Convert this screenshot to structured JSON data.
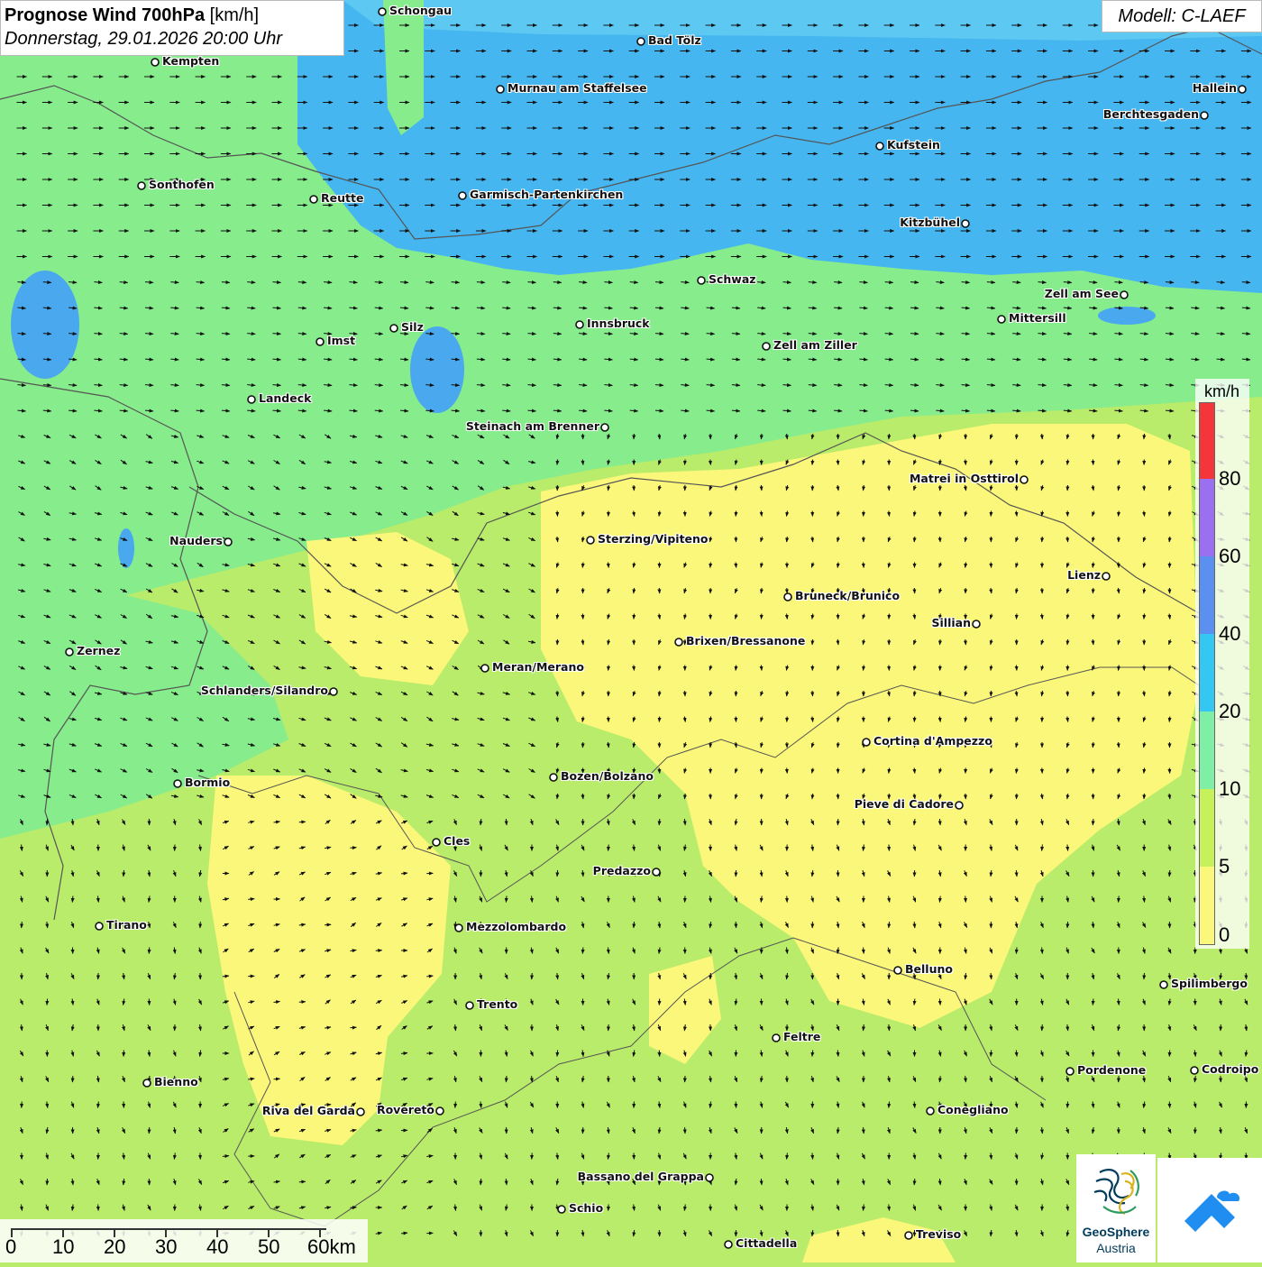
{
  "title": {
    "bold": "Prognose Wind 700hPa",
    "unit": " [km/h]",
    "date": "Donnerstag, 29.01.2026 20:00 Uhr"
  },
  "model": "Modell: C-LAEF",
  "legend": {
    "unit": "km/h",
    "colors": [
      "#fbf77a",
      "#c6f15b",
      "#7eefa5",
      "#34c7f2",
      "#5b8ff0",
      "#9a6ff0",
      "#f4363a"
    ],
    "labels": [
      "0",
      "5",
      "10",
      "20",
      "40",
      "60",
      "80"
    ]
  },
  "scale": {
    "labels": [
      "0",
      "10",
      "20",
      "30",
      "40",
      "50",
      "60km"
    ]
  },
  "colors": {
    "zone_0_5": "#fbf77a",
    "zone_5_10": "#c6f15b",
    "zone_10_20": "#7eefa5",
    "zone_20_40": "#34c7f2",
    "lake": "#4aa8ee",
    "border": "#555555"
  },
  "logos": {
    "geosphere": [
      "GeoSphere",
      "Austria"
    ]
  },
  "cities": [
    {
      "name": "Schongau",
      "side": "right"
    },
    {
      "name": "Bad Tölz",
      "side": "right"
    },
    {
      "name": "Kempten",
      "side": "right"
    },
    {
      "name": "Murnau am Staffelsee",
      "side": "right"
    },
    {
      "name": "Hallein",
      "side": "left"
    },
    {
      "name": "Berchtesgaden",
      "side": "left"
    },
    {
      "name": "Kufstein",
      "side": "right"
    },
    {
      "name": "Sonthofen",
      "side": "right"
    },
    {
      "name": "Reutte",
      "side": "right"
    },
    {
      "name": "Garmisch-Partenkirchen",
      "side": "right"
    },
    {
      "name": "Kitzbühel",
      "side": "left"
    },
    {
      "name": "Schwaz",
      "side": "right"
    },
    {
      "name": "Zell am See",
      "side": "left"
    },
    {
      "name": "Mittersill",
      "side": "right"
    },
    {
      "name": "Silz",
      "side": "right"
    },
    {
      "name": "Innsbruck",
      "side": "right"
    },
    {
      "name": "Imst",
      "side": "right"
    },
    {
      "name": "Zell am Ziller",
      "side": "right"
    },
    {
      "name": "Landeck",
      "side": "right"
    },
    {
      "name": "Steinach am Brenner",
      "side": "left"
    },
    {
      "name": "Matrei in Osttirol",
      "side": "left"
    },
    {
      "name": "Nauders",
      "side": "left"
    },
    {
      "name": "Sterzing/Vipiteno",
      "side": "right"
    },
    {
      "name": "Lienz",
      "side": "left"
    },
    {
      "name": "Bruneck/Brunico",
      "side": "right"
    },
    {
      "name": "Sillian",
      "side": "left"
    },
    {
      "name": "Brixen/Bressanone",
      "side": "right"
    },
    {
      "name": "Zernez",
      "side": "right"
    },
    {
      "name": "Meran/Merano",
      "side": "right"
    },
    {
      "name": "Schlanders/Silandro",
      "side": "left"
    },
    {
      "name": "Cortina d'Ampezzo",
      "side": "right"
    },
    {
      "name": "Bozen/Bolzano",
      "side": "right"
    },
    {
      "name": "Bormio",
      "side": "right"
    },
    {
      "name": "Pieve di Cadore",
      "side": "left"
    },
    {
      "name": "Cles",
      "side": "right"
    },
    {
      "name": "Predazzo",
      "side": "left"
    },
    {
      "name": "Tirano",
      "side": "right"
    },
    {
      "name": "Mezzolombardo",
      "side": "right"
    },
    {
      "name": "Belluno",
      "side": "right"
    },
    {
      "name": "Spilimbergo",
      "side": "right"
    },
    {
      "name": "Trento",
      "side": "right"
    },
    {
      "name": "Feltre",
      "side": "right"
    },
    {
      "name": "Pordenone",
      "side": "right"
    },
    {
      "name": "Codroipo",
      "side": "right"
    },
    {
      "name": "Bienno",
      "side": "right"
    },
    {
      "name": "Riva del Garda",
      "side": "left"
    },
    {
      "name": "Rovereto",
      "side": "left"
    },
    {
      "name": "Conegliano",
      "side": "right"
    },
    {
      "name": "Bassano del Grappa",
      "side": "left"
    },
    {
      "name": "Schio",
      "side": "right"
    },
    {
      "name": "Treviso",
      "side": "right"
    },
    {
      "name": "Cittadella",
      "side": "right"
    }
  ]
}
